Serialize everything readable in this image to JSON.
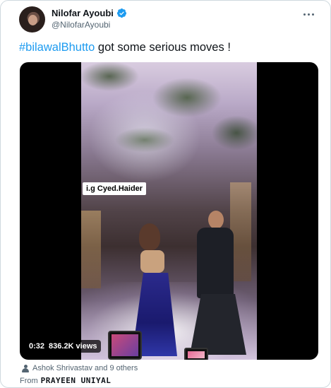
{
  "author": {
    "display_name": "Nilofar Ayoubi",
    "handle": "@NilofarAyoubi",
    "verified_icon": "verified-badge-icon",
    "verified_color": "#1d9bf0"
  },
  "tweet": {
    "hashtag": "#bilawalBhutto",
    "text": " got some serious moves !"
  },
  "media": {
    "watermark": "i.g Cyed.Haider",
    "duration": "0:32",
    "views": "836.2K views"
  },
  "footer": {
    "liked_by": "Ashok Shrivastav and 9 others",
    "from_label": "From",
    "from_name": "PRAYEEN UNIYAL"
  },
  "colors": {
    "accent": "#1d9bf0",
    "secondary_text": "#536471",
    "border": "#cfd9de"
  }
}
